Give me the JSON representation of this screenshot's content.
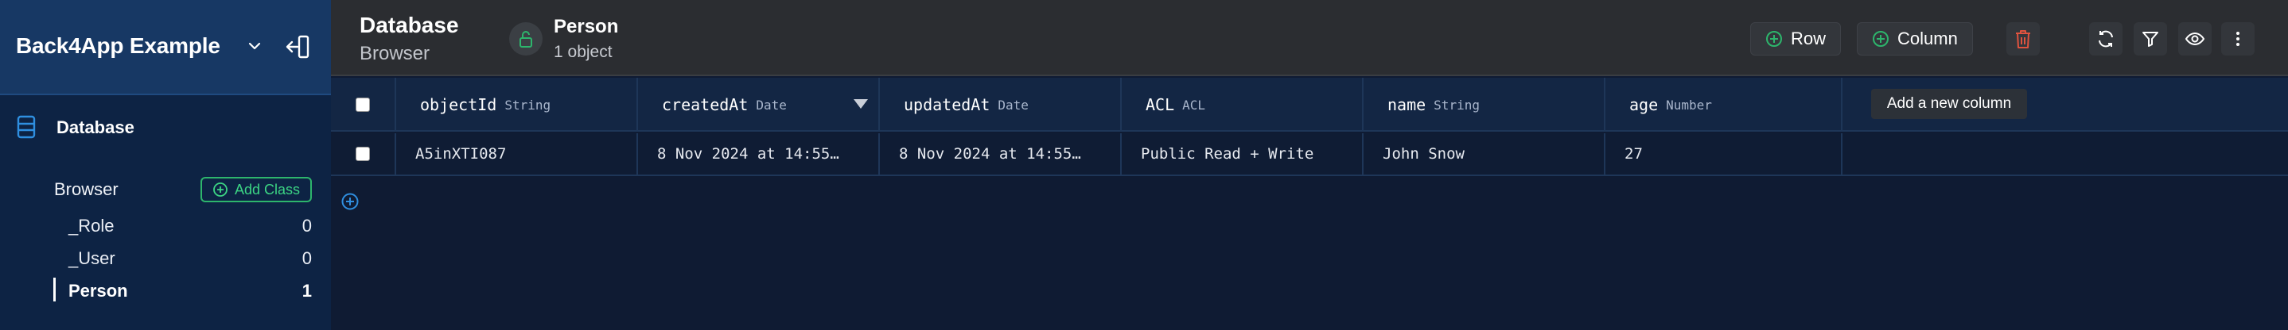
{
  "app": {
    "name": "Back4App Example"
  },
  "sidebar": {
    "section_label": "Database",
    "browser_label": "Browser",
    "add_class_label": "Add Class",
    "classes": [
      {
        "name": "_Role",
        "count": "0",
        "active": false
      },
      {
        "name": "_User",
        "count": "0",
        "active": false
      },
      {
        "name": "Person",
        "count": "1",
        "active": true
      }
    ]
  },
  "header": {
    "title": "Database",
    "subtitle": "Browser",
    "class_name": "Person",
    "class_count": "1 object",
    "row_label": "Row",
    "column_label": "Column"
  },
  "table": {
    "columns": [
      {
        "name": "objectId",
        "type": "String"
      },
      {
        "name": "createdAt",
        "type": "Date"
      },
      {
        "name": "updatedAt",
        "type": "Date"
      },
      {
        "name": "ACL",
        "type": "ACL"
      },
      {
        "name": "name",
        "type": "String"
      },
      {
        "name": "age",
        "type": "Number"
      }
    ],
    "add_column_tooltip": "Add a new column",
    "rows": [
      {
        "objectId": "A5inXTI087",
        "createdAt": "8 Nov 2024 at 14:55…",
        "updatedAt": "8 Nov 2024 at 14:55…",
        "ACL": "Public Read + Write",
        "name": "John Snow",
        "age": "27"
      }
    ]
  },
  "colors": {
    "accent_green": "#2db56c",
    "delete_red": "#e0533f",
    "sidebar_bg": "#0d2344",
    "table_bg": "#0f1b33"
  },
  "icons": [
    "chevron-down-icon",
    "collapse-sidebar-icon",
    "database-icon",
    "plus-circle-icon",
    "lock-icon",
    "trash-icon",
    "refresh-icon",
    "filter-icon",
    "eye-icon",
    "more-vertical-icon",
    "sort-desc-icon"
  ]
}
